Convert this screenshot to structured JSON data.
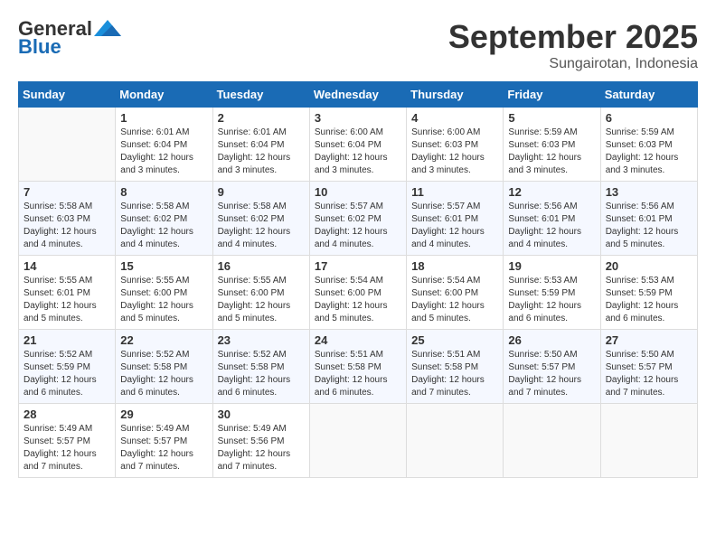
{
  "header": {
    "logo_line1": "General",
    "logo_line2": "Blue",
    "month": "September 2025",
    "location": "Sungairotan, Indonesia"
  },
  "days_of_week": [
    "Sunday",
    "Monday",
    "Tuesday",
    "Wednesday",
    "Thursday",
    "Friday",
    "Saturday"
  ],
  "weeks": [
    [
      {
        "day": "",
        "info": ""
      },
      {
        "day": "1",
        "info": "Sunrise: 6:01 AM\nSunset: 6:04 PM\nDaylight: 12 hours\nand 3 minutes."
      },
      {
        "day": "2",
        "info": "Sunrise: 6:01 AM\nSunset: 6:04 PM\nDaylight: 12 hours\nand 3 minutes."
      },
      {
        "day": "3",
        "info": "Sunrise: 6:00 AM\nSunset: 6:04 PM\nDaylight: 12 hours\nand 3 minutes."
      },
      {
        "day": "4",
        "info": "Sunrise: 6:00 AM\nSunset: 6:03 PM\nDaylight: 12 hours\nand 3 minutes."
      },
      {
        "day": "5",
        "info": "Sunrise: 5:59 AM\nSunset: 6:03 PM\nDaylight: 12 hours\nand 3 minutes."
      },
      {
        "day": "6",
        "info": "Sunrise: 5:59 AM\nSunset: 6:03 PM\nDaylight: 12 hours\nand 3 minutes."
      }
    ],
    [
      {
        "day": "7",
        "info": "Sunrise: 5:58 AM\nSunset: 6:03 PM\nDaylight: 12 hours\nand 4 minutes."
      },
      {
        "day": "8",
        "info": "Sunrise: 5:58 AM\nSunset: 6:02 PM\nDaylight: 12 hours\nand 4 minutes."
      },
      {
        "day": "9",
        "info": "Sunrise: 5:58 AM\nSunset: 6:02 PM\nDaylight: 12 hours\nand 4 minutes."
      },
      {
        "day": "10",
        "info": "Sunrise: 5:57 AM\nSunset: 6:02 PM\nDaylight: 12 hours\nand 4 minutes."
      },
      {
        "day": "11",
        "info": "Sunrise: 5:57 AM\nSunset: 6:01 PM\nDaylight: 12 hours\nand 4 minutes."
      },
      {
        "day": "12",
        "info": "Sunrise: 5:56 AM\nSunset: 6:01 PM\nDaylight: 12 hours\nand 4 minutes."
      },
      {
        "day": "13",
        "info": "Sunrise: 5:56 AM\nSunset: 6:01 PM\nDaylight: 12 hours\nand 5 minutes."
      }
    ],
    [
      {
        "day": "14",
        "info": "Sunrise: 5:55 AM\nSunset: 6:01 PM\nDaylight: 12 hours\nand 5 minutes."
      },
      {
        "day": "15",
        "info": "Sunrise: 5:55 AM\nSunset: 6:00 PM\nDaylight: 12 hours\nand 5 minutes."
      },
      {
        "day": "16",
        "info": "Sunrise: 5:55 AM\nSunset: 6:00 PM\nDaylight: 12 hours\nand 5 minutes."
      },
      {
        "day": "17",
        "info": "Sunrise: 5:54 AM\nSunset: 6:00 PM\nDaylight: 12 hours\nand 5 minutes."
      },
      {
        "day": "18",
        "info": "Sunrise: 5:54 AM\nSunset: 6:00 PM\nDaylight: 12 hours\nand 5 minutes."
      },
      {
        "day": "19",
        "info": "Sunrise: 5:53 AM\nSunset: 5:59 PM\nDaylight: 12 hours\nand 6 minutes."
      },
      {
        "day": "20",
        "info": "Sunrise: 5:53 AM\nSunset: 5:59 PM\nDaylight: 12 hours\nand 6 minutes."
      }
    ],
    [
      {
        "day": "21",
        "info": "Sunrise: 5:52 AM\nSunset: 5:59 PM\nDaylight: 12 hours\nand 6 minutes."
      },
      {
        "day": "22",
        "info": "Sunrise: 5:52 AM\nSunset: 5:58 PM\nDaylight: 12 hours\nand 6 minutes."
      },
      {
        "day": "23",
        "info": "Sunrise: 5:52 AM\nSunset: 5:58 PM\nDaylight: 12 hours\nand 6 minutes."
      },
      {
        "day": "24",
        "info": "Sunrise: 5:51 AM\nSunset: 5:58 PM\nDaylight: 12 hours\nand 6 minutes."
      },
      {
        "day": "25",
        "info": "Sunrise: 5:51 AM\nSunset: 5:58 PM\nDaylight: 12 hours\nand 7 minutes."
      },
      {
        "day": "26",
        "info": "Sunrise: 5:50 AM\nSunset: 5:57 PM\nDaylight: 12 hours\nand 7 minutes."
      },
      {
        "day": "27",
        "info": "Sunrise: 5:50 AM\nSunset: 5:57 PM\nDaylight: 12 hours\nand 7 minutes."
      }
    ],
    [
      {
        "day": "28",
        "info": "Sunrise: 5:49 AM\nSunset: 5:57 PM\nDaylight: 12 hours\nand 7 minutes."
      },
      {
        "day": "29",
        "info": "Sunrise: 5:49 AM\nSunset: 5:57 PM\nDaylight: 12 hours\nand 7 minutes."
      },
      {
        "day": "30",
        "info": "Sunrise: 5:49 AM\nSunset: 5:56 PM\nDaylight: 12 hours\nand 7 minutes."
      },
      {
        "day": "",
        "info": ""
      },
      {
        "day": "",
        "info": ""
      },
      {
        "day": "",
        "info": ""
      },
      {
        "day": "",
        "info": ""
      }
    ]
  ]
}
